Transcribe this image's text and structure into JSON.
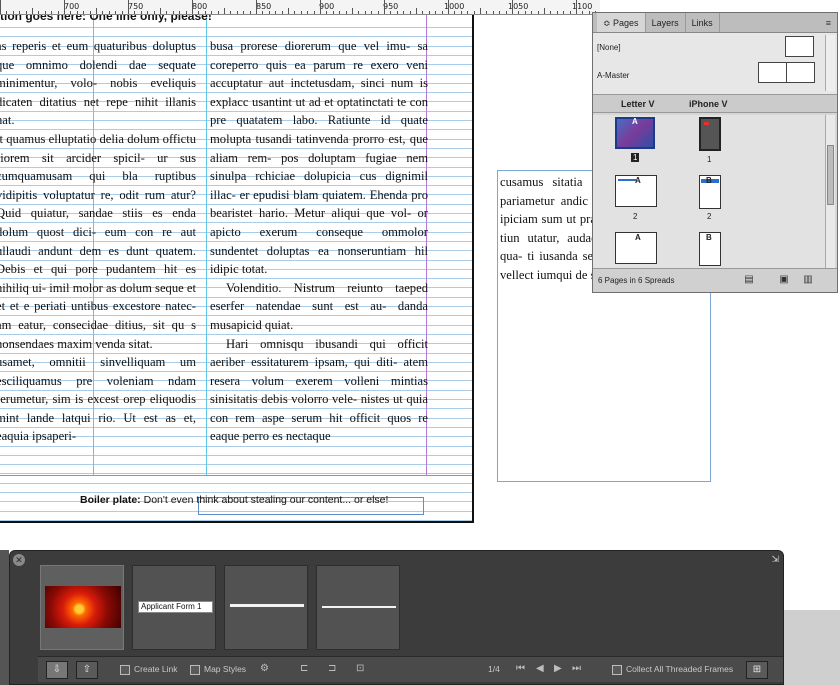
{
  "ruler": {
    "labels": [
      "700",
      "750",
      "800",
      "850",
      "900",
      "950",
      "1000",
      "1050",
      "1100"
    ]
  },
  "document": {
    "headline": "tion goes here: One line only, please!",
    "column1": [
      "as reperis et eum quaturibus doluptus que omnimo dolendi dae sequate minimentur, volo- nobis eveliquis dicaten ditatius net repe nihit illanis nat.",
      "it quamus elluptatio delia dolum offictu riorem sit arcider spicil- ur sus cumquamusam qui bla ruptibus vidipitis voluptatur re, odit rum atur? Quid quiatur, sandae stiis es enda dolum quost dici- eum con re aut ullaudi andunt dem es dunt quatem. Debis et qui pore pudantem hit es nihiliq ui- imil molor as dolum seque et et et e periati untibus excestore natec- am eatur, consecidae ditius, sit qu s nonsendaes maxim venda sitat.",
      "usamet, omnitii sinvelliquam um esciliquamus pre voleniam ndam rerumetur, sim is excest orep eliquodis mint lande latqui rio. Ut est as et, eaquia ipsaperi-"
    ],
    "column2": [
      "busa prorese diorerum que vel imu- sa coreperro quis ea parum re exero veni accuptatur aut inctetusdam, sinci num is explacc usantint ut ad et optatinctati te con pre quatatem labo. Ratiunte id quate molupta tusandi tatinvenda prorro est, que aliam rem- pos doluptam fugiae nem sinulpa rchiciae dolupicia cus dignimil illac- er epudisi blam quiatem. Ehenda pro bearistet hario. Metur aliqui que vol- or apicto exerum conseque ommolor sundentet doluptas ea nonseruntiam hil idipic totat.",
      "Volenditio. Nistrum reiunto taeped eserfer natendae sunt est au- danda musapicid quiat.",
      "Hari omnisqu ibusandi qui officit aeriber essitaturem ipsam, qui diti- atem resera volum exerem volleni mintias sinisitatis debis volorro vele- nistes ut quia con rem aspe serum hit officit quos re eaque perro es nectaque"
    ],
    "boilerplate_label": "Boiler plate:",
    "boilerplate_text": "Don't even think about stealing our content... or else!",
    "overflow_text": "cusamus sitatia s po rernatiis as ec pariametur andic dolupie nducient pori ipiciam sum ut pra sandaept rum solupta tiun utatur, audae. Sit hicitatem aped qua- ti iusanda seque cus ut velesequos vellect iumqui de sa volessi..."
  },
  "pages_panel": {
    "tabs": [
      "≎ Pages",
      "Layers",
      "Links"
    ],
    "menu": "≡",
    "masters": [
      {
        "label": "[None]"
      },
      {
        "label": "A-Master"
      }
    ],
    "column_headers": [
      "Letter V",
      "iPhone V"
    ],
    "pages": [
      {
        "label": "1",
        "master": "A"
      },
      {
        "label": "1",
        "master": ""
      },
      {
        "label": "2",
        "master": "A"
      },
      {
        "label": "2",
        "master": "B"
      },
      {
        "label": "",
        "master": "A"
      },
      {
        "label": "",
        "master": "B"
      }
    ],
    "footer": "6 Pages in 6 Spreads"
  },
  "collector": {
    "form_label": "Applicant Form 1",
    "resize_glyph": "⇲",
    "toolbar": {
      "create_link": "Create Link",
      "map_styles": "Map Styles",
      "page_count": "1/4",
      "collect_threaded": "Collect All Threaded Frames"
    }
  }
}
